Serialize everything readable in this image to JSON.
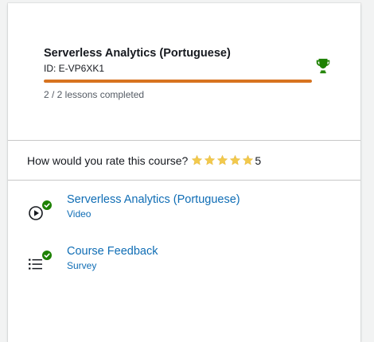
{
  "course": {
    "title": "Serverless Analytics (Portuguese)",
    "id_label": "ID: E-VP6XK1",
    "progress": 1.0,
    "lessons_completed": "2 / 2 lessons completed",
    "trophy_icon": "trophy-icon"
  },
  "rating": {
    "question": "How would you rate this course?",
    "stars": 5,
    "value": "5"
  },
  "items": [
    {
      "title": "Serverless Analytics (Portuguese)",
      "type": "Video",
      "icon": "play-circle-icon",
      "completed": true
    },
    {
      "title": "Course Feedback",
      "type": "Survey",
      "icon": "list-icon",
      "completed": true
    }
  ],
  "colors": {
    "accent_orange": "#d7731f",
    "link_blue": "#0f6db5",
    "success_green": "#1d8102",
    "star_yellow": "#f2c94c"
  }
}
